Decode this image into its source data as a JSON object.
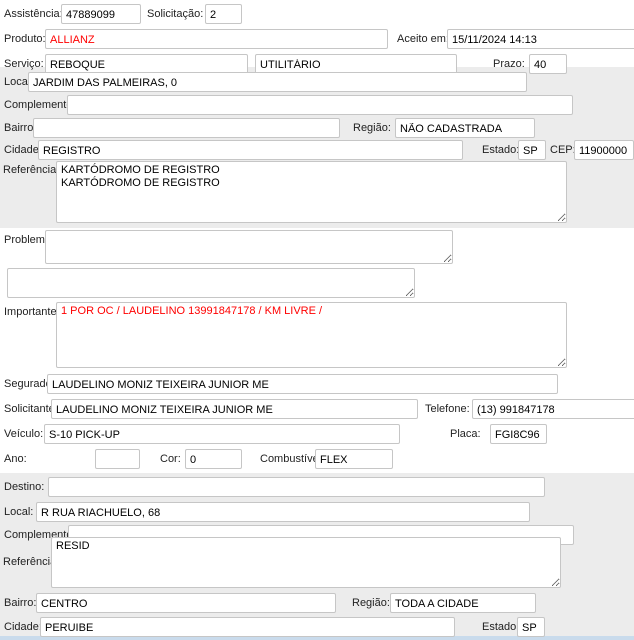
{
  "colors": {
    "highlight_red": "#ff0000",
    "section_gray": "#ececec",
    "bottom_separator_blue": "#c9dbec",
    "input_border": "#c6c6c6"
  },
  "top": {
    "assistencia": {
      "label": "Assistência:",
      "value": "47889099"
    },
    "solicitacao": {
      "label": "Solicitação:",
      "value": "2"
    },
    "produto": {
      "label": "Produto:",
      "value": "ALLIANZ"
    },
    "aceito_em": {
      "label": "Aceito em:",
      "value": "15/11/2024 14:13"
    },
    "servico": {
      "label": "Serviço:",
      "value": "REBOQUE",
      "tipo": "UTILITÁRIO"
    },
    "prazo": {
      "label": "Prazo:",
      "value": "40"
    }
  },
  "origem": {
    "local": {
      "label": "Local:",
      "value": "JARDIM DAS PALMEIRAS, 0"
    },
    "complemento": {
      "label": "Complemento:",
      "value": ""
    },
    "bairro": {
      "label": "Bairro:",
      "value": ""
    },
    "regiao": {
      "label": "Região:",
      "value": "NÃO CADASTRADA"
    },
    "cidade": {
      "label": "Cidade:",
      "value": "REGISTRO"
    },
    "estado": {
      "label": "Estado:",
      "value": "SP"
    },
    "cep": {
      "label": "CEP:",
      "value": "11900000"
    },
    "referencias": {
      "label": "Referências:",
      "value": "KARTÓDROMO DE REGISTRO\nKARTÓDROMO DE REGISTRO"
    }
  },
  "detalhes": {
    "problema": {
      "label": "Problema:",
      "value": ""
    },
    "observacao": {
      "value": ""
    },
    "importante": {
      "label": "Importante:",
      "value": "1 POR OC / LAUDELINO 13991847178 / KM LIVRE /"
    },
    "segurado": {
      "label": "Segurado:",
      "value": "LAUDELINO MONIZ TEIXEIRA JUNIOR ME"
    },
    "solicitante": {
      "label": "Solicitante:",
      "value": "LAUDELINO MONIZ TEIXEIRA JUNIOR ME"
    },
    "telefone": {
      "label": "Telefone:",
      "value": "(13) 991847178"
    },
    "veiculo": {
      "label": "Veículo:",
      "value": "S-10 PICK-UP"
    },
    "placa": {
      "label": "Placa:",
      "value": "FGI8C96"
    },
    "ano": {
      "label": "Ano:",
      "value": ""
    },
    "cor": {
      "label": "Cor:",
      "value": "0"
    },
    "combustivel": {
      "label": "Combustível:",
      "value": "FLEX"
    }
  },
  "destino": {
    "destino": {
      "label": "Destino:",
      "value": ""
    },
    "local": {
      "label": "Local:",
      "value": "R RUA RIACHUELO, 68"
    },
    "complemento": {
      "label": "Complemento:",
      "value": ""
    },
    "referencia": {
      "label": "Referência:",
      "value": "RESID"
    },
    "bairro": {
      "label": "Bairro:",
      "value": "CENTRO"
    },
    "regiao": {
      "label": "Região:",
      "value": "TODA A CIDADE"
    },
    "cidade": {
      "label": "Cidade:",
      "value": "PERUIBE"
    },
    "estado": {
      "label": "Estado:",
      "value": "SP"
    }
  }
}
